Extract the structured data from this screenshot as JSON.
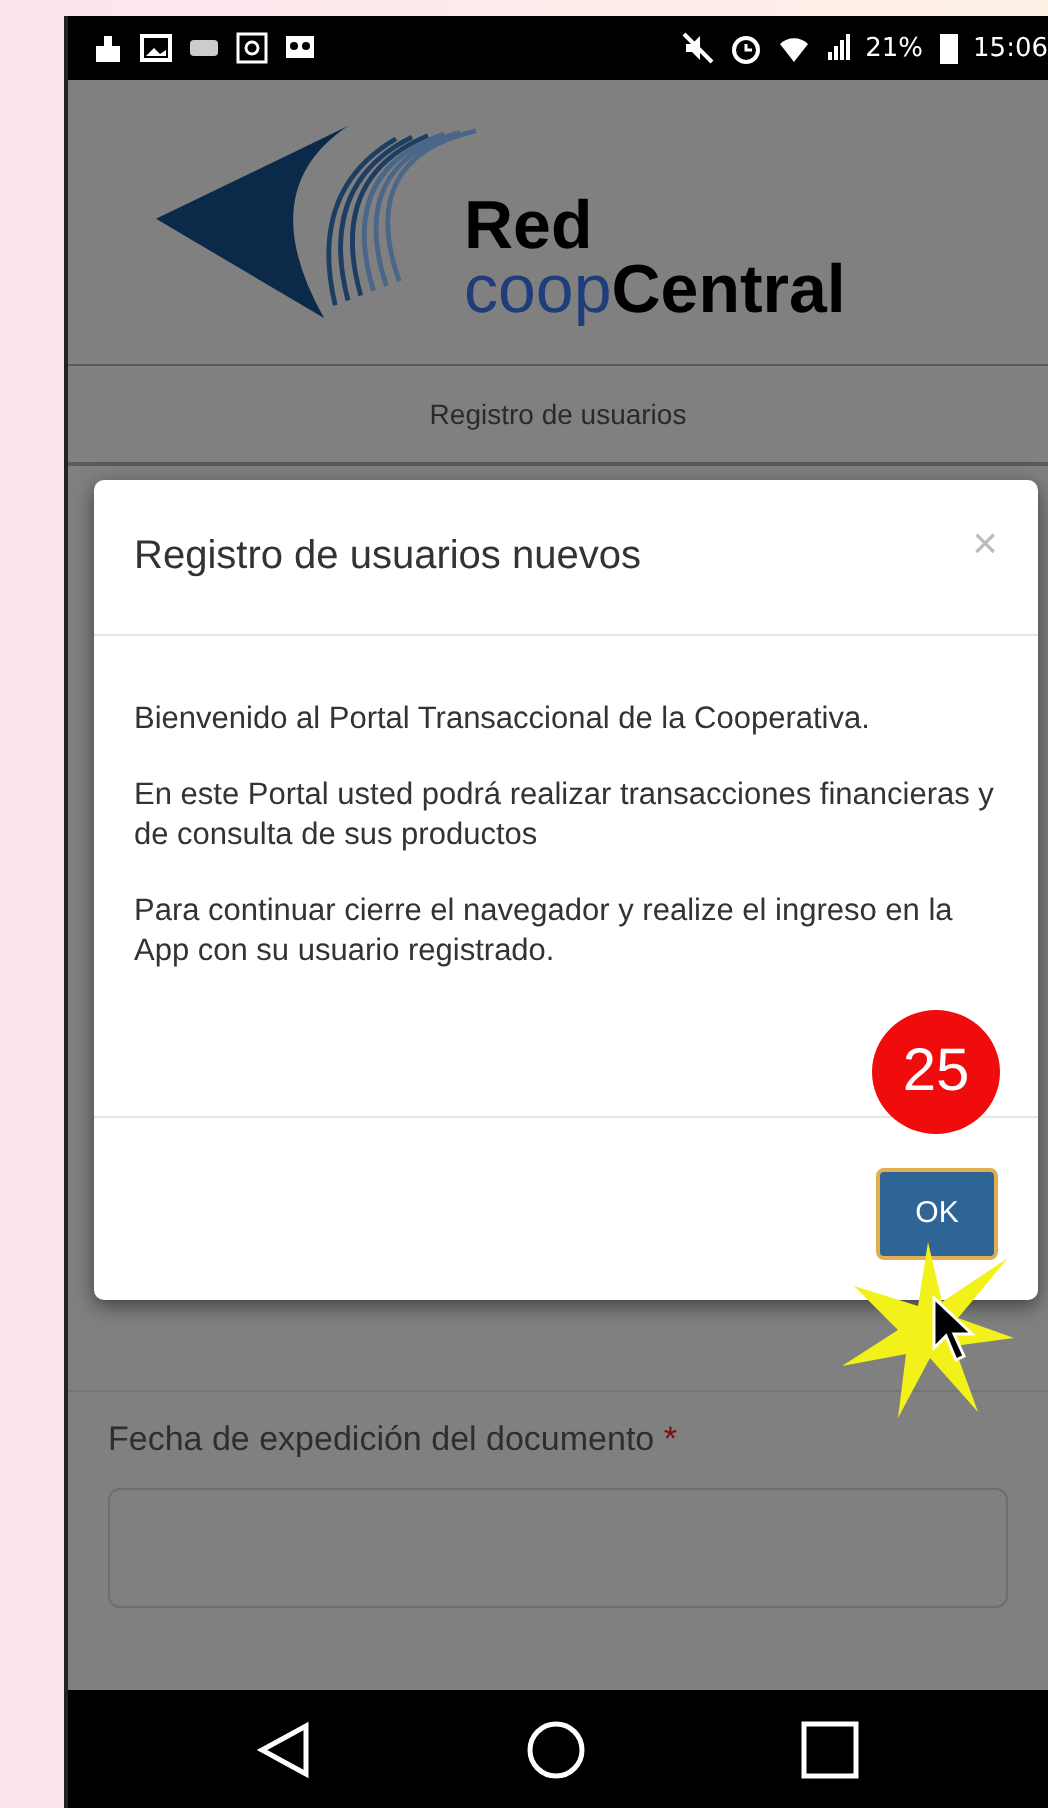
{
  "status_bar": {
    "battery": "21%",
    "time": "15:06"
  },
  "logo": {
    "line_1": "Red",
    "line_2_accent": "coop",
    "line_2": "Central"
  },
  "nav": {
    "title": "Registro de usuarios"
  },
  "form": {
    "field_label": "Fecha de expedición del documento",
    "required_mark": "*"
  },
  "dialog": {
    "title": "Registro de usuarios nuevos",
    "close": "×",
    "paragraphs": [
      "Bienvenido al Portal Transaccional de la Cooperativa.",
      "En este Portal usted podrá realizar transacciones financieras y de consulta de sus productos",
      "Para continuar cierre el navegador y realize el ingreso en la App con su usuario registrado."
    ],
    "button": "OK"
  },
  "annotation": {
    "step": "25"
  }
}
